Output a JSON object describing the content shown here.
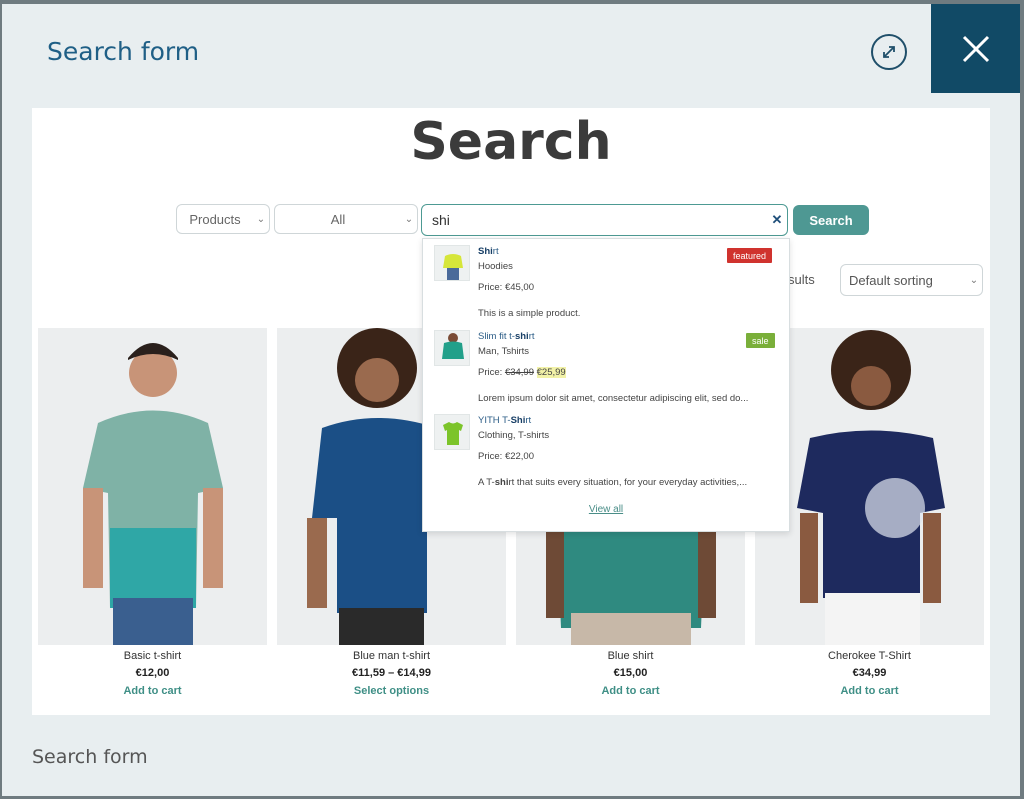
{
  "modal": {
    "title": "Search form",
    "footer": "Search form"
  },
  "page": {
    "heading": "Search"
  },
  "search": {
    "post_type": "Products",
    "category": "All",
    "query": "shi",
    "button": "Search"
  },
  "toolbar": {
    "results_text": "sults",
    "sorting": "Default sorting"
  },
  "dropdown": {
    "items": [
      {
        "title_match": "Shi",
        "title_rest": "rt",
        "title_prefix": "",
        "category": "Hoodies",
        "price_label": "Price: ",
        "price": "€45,00",
        "description": "This is a simple product.",
        "badge": "featured"
      },
      {
        "title_prefix": "Slim fit t-",
        "title_match": "shi",
        "title_rest": "rt",
        "category": "Man, Tshirts",
        "price_label": "Price: ",
        "old_price": "€34,99",
        "price": "€25,99",
        "description": "Lorem ipsum dolor sit amet, consectetur adipiscing elit, sed do...",
        "badge": "sale"
      },
      {
        "title_prefix": "YITH T-",
        "title_match": "Shi",
        "title_rest": "rt",
        "category": "Clothing, T-shirts",
        "price_label": "Price: ",
        "price": "€22,00",
        "description_prefix": "A T-",
        "description_match": "shi",
        "description_rest": "rt that suits every situation, for your everyday activities,..."
      }
    ],
    "view_all": "View all"
  },
  "products": [
    {
      "name": "Basic t-shirt",
      "price": "€12,00",
      "action": "Add to cart"
    },
    {
      "name": "Blue man t-shirt",
      "price": "€11,59 – €14,99",
      "action": "Select options"
    },
    {
      "name": "Blue shirt",
      "price": "€15,00",
      "action": "Add to cart"
    },
    {
      "name": "Cherokee T-Shirt",
      "price": "€34,99",
      "action": "Add to cart"
    }
  ],
  "colors": {
    "accent": "#4e9893",
    "close_bg": "#114a66",
    "featured": "#d0332e",
    "sale": "#7aaf3a"
  }
}
